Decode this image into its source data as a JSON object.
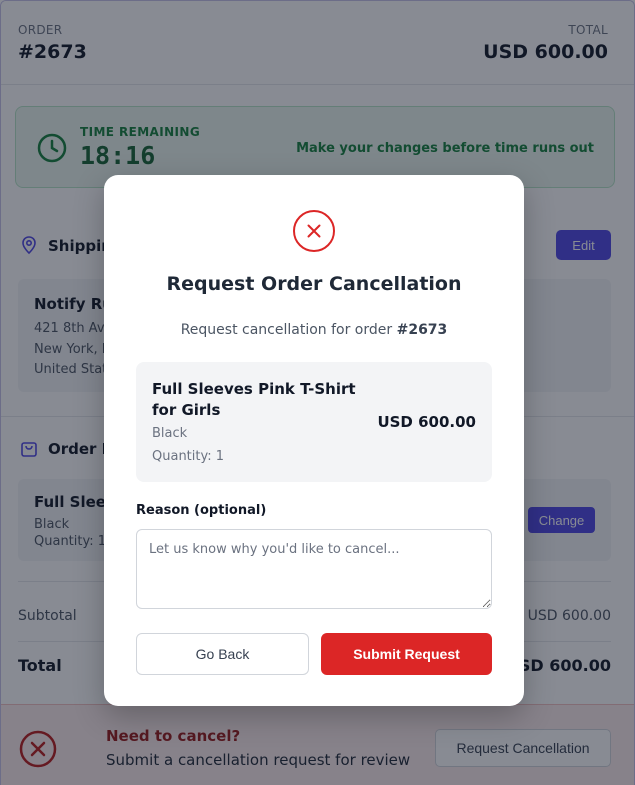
{
  "header": {
    "order_label": "ORDER",
    "order_number": "#2673",
    "total_label": "TOTAL",
    "total_value": "USD 600.00"
  },
  "timer": {
    "label": "TIME REMAINING",
    "value": "18:16",
    "message": "Make your changes before time runs out",
    "icon": "clock-icon"
  },
  "shipping": {
    "title": "Shipping",
    "edit_label": "Edit",
    "name": "Notify Ru",
    "lines": [
      "421 8th Ave",
      "New York, N",
      "United State"
    ]
  },
  "order_items": {
    "title": "Order It",
    "item_name": "Full Sleeve",
    "color": "Black",
    "quantity": "Quantity: 1",
    "change_label": "Change"
  },
  "summary": {
    "subtotal_label": "Subtotal",
    "subtotal_value": "USD 600.00",
    "total_label": "Total",
    "total_value": "USD 600.00"
  },
  "footer": {
    "title": "Need to cancel?",
    "subtitle": "Submit a cancellation request for review",
    "button_label": "Request Cancellation"
  },
  "modal": {
    "title": "Request Order Cancellation",
    "subtitle_prefix": "Request cancellation for order ",
    "order_number": "#2673",
    "item": {
      "name": "Full Sleeves Pink T-Shirt for Girls",
      "color": "Black",
      "quantity": "Quantity: 1",
      "price": "USD 600.00"
    },
    "reason_label": "Reason (optional)",
    "reason_placeholder": "Let us know why you'd like to cancel...",
    "reason_value": "",
    "back_label": "Go Back",
    "submit_label": "Submit Request"
  },
  "colors": {
    "accent": "#4f46e5",
    "danger": "#dc2626",
    "success": "#15803d"
  }
}
